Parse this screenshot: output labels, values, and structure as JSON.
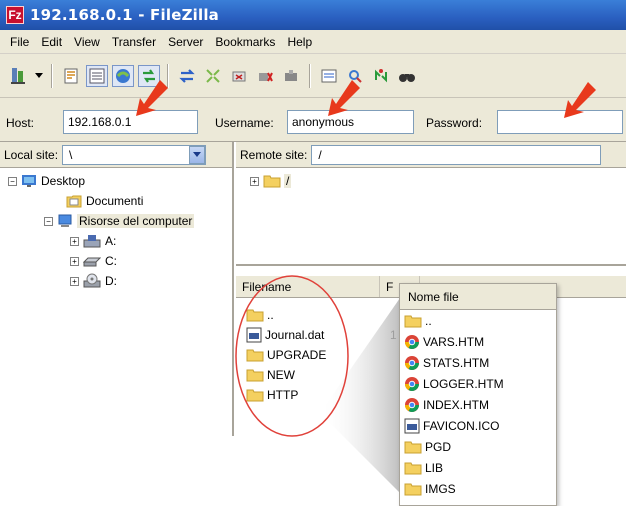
{
  "window": {
    "title": "192.168.0.1 - FileZilla",
    "app_icon": "Fz"
  },
  "menu": [
    "File",
    "Edit",
    "View",
    "Transfer",
    "Server",
    "Bookmarks",
    "Help"
  ],
  "quickconnect": {
    "host_label": "Host:",
    "host_value": "192.168.0.1",
    "username_label": "Username:",
    "username_value": "anonymous",
    "password_label": "Password:",
    "password_value": ""
  },
  "local": {
    "label": "Local site:",
    "path": "\\",
    "tree": [
      "Desktop",
      "Documenti",
      "Risorse del computer",
      "A:",
      "C:",
      "D:"
    ]
  },
  "remote": {
    "label": "Remote site:",
    "path": "/",
    "tree_root": "/",
    "columns": [
      "Filename",
      "F"
    ],
    "files": [
      {
        "name": "..",
        "type": "folder",
        "size": ""
      },
      {
        "name": "Journal.dat",
        "type": "file",
        "size": "1"
      },
      {
        "name": "UPGRADE",
        "type": "folder",
        "size": ""
      },
      {
        "name": "NEW",
        "type": "folder",
        "size": ""
      },
      {
        "name": "HTTP",
        "type": "folder",
        "size": ""
      }
    ]
  },
  "zoom": {
    "header": "Nome file",
    "files": [
      {
        "name": "..",
        "type": "folder"
      },
      {
        "name": "VARS.HTM",
        "type": "html"
      },
      {
        "name": "STATS.HTM",
        "type": "html"
      },
      {
        "name": "LOGGER.HTM",
        "type": "html"
      },
      {
        "name": "INDEX.HTM",
        "type": "html"
      },
      {
        "name": "FAVICON.ICO",
        "type": "file"
      },
      {
        "name": "PGD",
        "type": "folder"
      },
      {
        "name": "LIB",
        "type": "folder"
      },
      {
        "name": "IMGS",
        "type": "folder"
      }
    ]
  },
  "colors": {
    "title_bar": "#2a5fc0",
    "annotation_arrow": "#e8391c",
    "annotation_circle": "#e0413a",
    "chrome": "#ece9d8"
  }
}
